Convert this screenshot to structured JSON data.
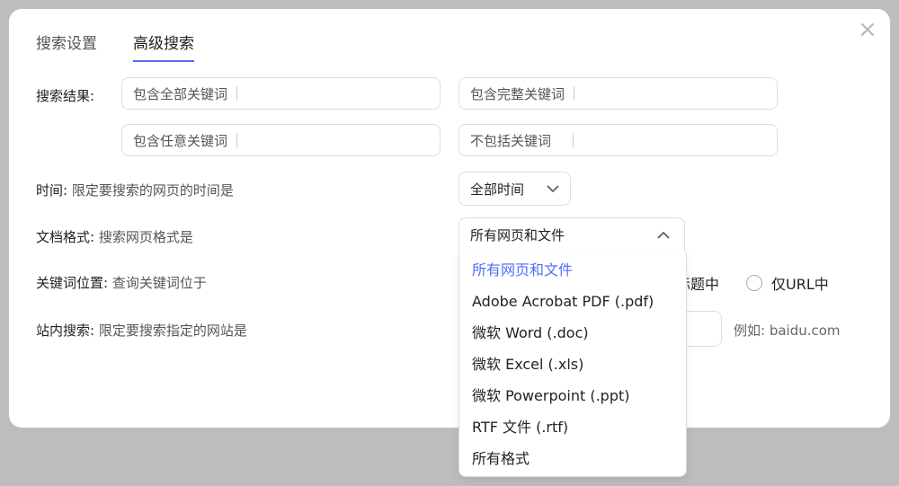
{
  "tabs": [
    {
      "label": "搜索设置"
    },
    {
      "label": "高级搜索"
    }
  ],
  "close_icon": "×",
  "search_results": {
    "label": "搜索结果:",
    "all_keywords": "包含全部关键词",
    "exact_phrase": "包含完整关键词",
    "any_keywords": "包含任意关键词",
    "exclude_keywords": "不包括关键词"
  },
  "time": {
    "label": "时间:",
    "desc": "限定要搜索的网页的时间是",
    "value": "全部时间"
  },
  "format": {
    "label": "文档格式:",
    "desc": "搜索网页格式是",
    "value": "所有网页和文件",
    "options": [
      "所有网页和文件",
      "Adobe Acrobat PDF (.pdf)",
      "微软 Word (.doc)",
      "微软 Excel (.xls)",
      "微软 Powerpoint (.ppt)",
      "RTF 文件  (.rtf)",
      "所有格式"
    ]
  },
  "keyword_position": {
    "label": "关键词位置:",
    "desc": "查询关键词位于",
    "option_title_partial": "标题中",
    "option_url": "仅URL中"
  },
  "site_search": {
    "label": "站内搜索:",
    "desc": "限定要搜索指定的网站是",
    "example": "例如: baidu.com"
  },
  "colors": {
    "accent": "#4e6ef2"
  }
}
